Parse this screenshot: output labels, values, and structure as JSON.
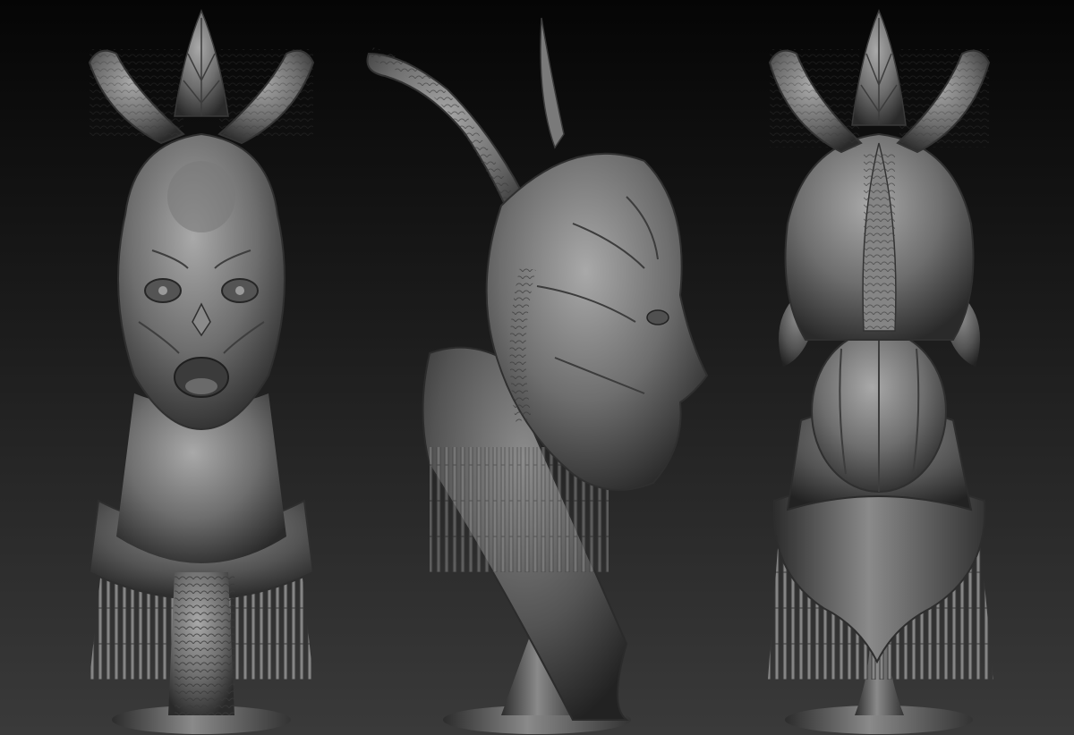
{
  "scene": {
    "colors": {
      "background_top": "#050505",
      "background_bottom": "#3a3a3a",
      "clay_highlight": "#a9a9a9",
      "clay_mid": "#6e6e6e",
      "clay_shadow": "#2a2a2a"
    },
    "views": [
      {
        "view": "front"
      },
      {
        "view": "side-left"
      },
      {
        "view": "back"
      }
    ]
  }
}
